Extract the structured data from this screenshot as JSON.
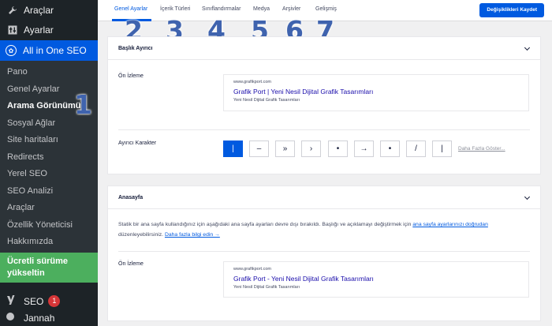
{
  "sidebar": {
    "top_items": [
      {
        "label": "Araçlar",
        "icon": "wrench-icon"
      },
      {
        "label": "Ayarlar",
        "icon": "settings-icon"
      }
    ],
    "active_menu": {
      "label": "All in One SEO",
      "icon": "aioseo-icon"
    },
    "sub_items": [
      {
        "label": "Pano"
      },
      {
        "label": "Genel Ayarlar"
      },
      {
        "label": "Arama Görünümü"
      },
      {
        "label": "Sosyal Ağlar"
      },
      {
        "label": "Site haritaları"
      },
      {
        "label": "Redirects"
      },
      {
        "label": "Yerel SEO"
      },
      {
        "label": "SEO Analizi"
      },
      {
        "label": "Araçlar"
      },
      {
        "label": "Özellik Yöneticisi"
      },
      {
        "label": "Hakkımızda"
      }
    ],
    "upgrade_label": "Ücretli sürüme yükseltin",
    "seo_item": {
      "label": "SEO",
      "badge": "1",
      "icon": "yoast-icon"
    },
    "cut_item": {
      "label": "Jannah"
    }
  },
  "tabs": [
    "Genel Ayarlar",
    "İçerik Türleri",
    "Sınıflandırmalar",
    "Medya",
    "Arşivler",
    "Gelişmiş"
  ],
  "save_button": "Değişiklikleri Kaydet",
  "annotations": [
    "1",
    "2",
    "3",
    "4",
    "5",
    "6",
    "7"
  ],
  "title_separator": {
    "heading": "Başlık Ayırıcı",
    "preview_label": "Ön İzleme",
    "preview": {
      "url": "www.grafikport.com",
      "title": "Grafik Port | Yeni Nesil Dijital Grafik Tasarımları",
      "desc": "Yeni Nesil Dijital Grafik Tasarımları"
    },
    "separator_label": "Ayırıcı Karakter",
    "separators": [
      "|",
      "–",
      "»",
      "›",
      "•",
      "→",
      "•",
      "/",
      "|"
    ],
    "more_link": "Daha Fazla Göster..."
  },
  "homepage": {
    "heading": "Anasayfa",
    "text_1": "Statik bir ana sayfa kullandığınız için aşağıdaki ana sayfa ayarları devre dışı bırakıldı. Başlığı ve açıklamayı değiştirmek için",
    "link_1": "ana sayfa ayarlarınızı doğrudan",
    "text_2": "düzenleyebilirsiniz.",
    "link_2": "Daha fazla bilgi edin →",
    "preview_label": "Ön İzleme",
    "preview": {
      "url": "www.grafikport.com",
      "title": "Grafik Port - Yeni Nesil Dijital Grafik Tasarımları",
      "desc": "Yeni Nesil Dijital Grafik Tasarımları"
    }
  },
  "colors": {
    "accent": "#005ae0",
    "sidebar": "#1d2327",
    "upgrade": "#4caf5e",
    "annotation": "#3f63ae"
  }
}
